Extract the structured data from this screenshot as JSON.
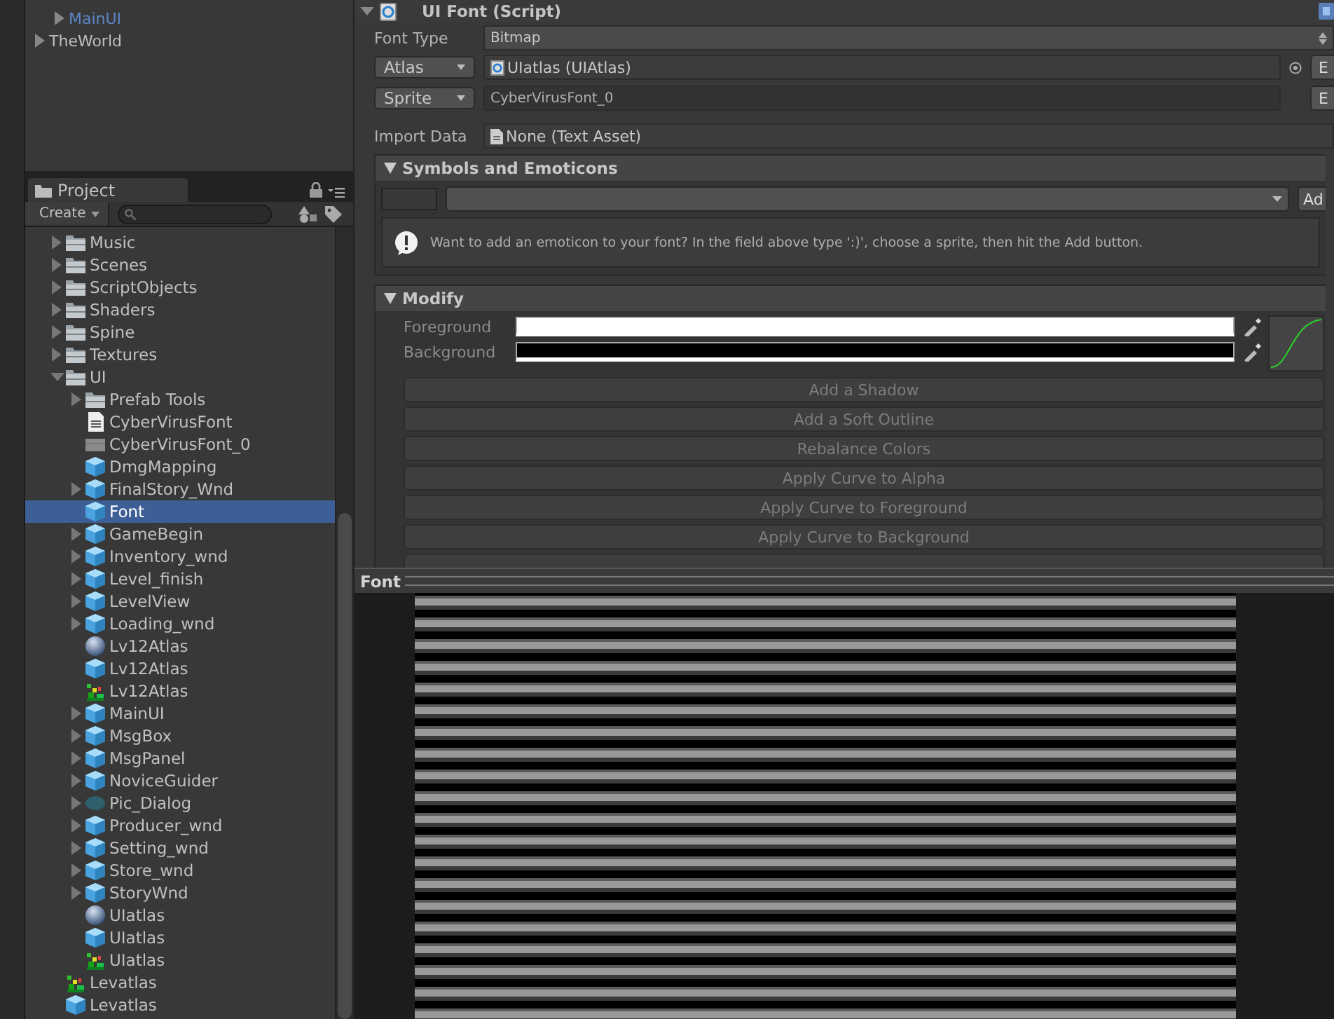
{
  "hierarchy": {
    "items": [
      {
        "children": [
          {
            "label": "MainUI",
            "prefab": true,
            "expanded": false,
            "selected": false
          }
        ]
      },
      {
        "label": "TheWorld",
        "prefab": false,
        "expanded": false,
        "selected": false
      }
    ]
  },
  "project": {
    "tab": "Project",
    "create_button": "Create",
    "tree": [
      {
        "label": "Music",
        "kind": "folder",
        "expanded": false,
        "selected": false
      },
      {
        "label": "Scenes",
        "kind": "folder",
        "expanded": false,
        "selected": false
      },
      {
        "label": "ScriptObjects",
        "kind": "folder",
        "expanded": false,
        "selected": false
      },
      {
        "label": "Shaders",
        "kind": "folder",
        "expanded": false,
        "selected": false
      },
      {
        "label": "Spine",
        "kind": "folder",
        "expanded": false,
        "selected": false
      },
      {
        "label": "Textures",
        "kind": "folder",
        "expanded": false,
        "selected": false
      },
      {
        "label": "UI",
        "kind": "folder",
        "expanded": true,
        "selected": false,
        "children": [
          {
            "label": "Prefab Tools",
            "kind": "folder",
            "expanded": false,
            "selected": false
          },
          {
            "label": "CyberVirusFont",
            "kind": "text",
            "selected": false
          },
          {
            "label": "CyberVirusFont_0",
            "kind": "texture",
            "selected": false
          },
          {
            "label": "DmgMapping",
            "kind": "prefab",
            "selected": false
          },
          {
            "label": "FinalStory_Wnd",
            "kind": "prefab",
            "expanded": false,
            "selected": false
          },
          {
            "label": "Font",
            "kind": "prefab",
            "selected": true
          },
          {
            "label": "GameBegin",
            "kind": "prefab",
            "expanded": false,
            "selected": false
          },
          {
            "label": "Inventory_wnd",
            "kind": "prefab",
            "expanded": false,
            "selected": false
          },
          {
            "label": "Level_finish",
            "kind": "prefab",
            "expanded": false,
            "selected": false
          },
          {
            "label": "LevelView",
            "kind": "prefab",
            "expanded": false,
            "selected": false
          },
          {
            "label": "Loading_wnd",
            "kind": "prefab",
            "expanded": false,
            "selected": false
          },
          {
            "label": "Lv12Atlas",
            "kind": "material",
            "selected": false
          },
          {
            "label": "Lv12Atlas",
            "kind": "prefab",
            "selected": false
          },
          {
            "label": "Lv12Atlas",
            "kind": "atlas",
            "selected": false
          },
          {
            "label": "MainUI",
            "kind": "prefab",
            "expanded": false,
            "selected": false
          },
          {
            "label": "MsgBox",
            "kind": "prefab",
            "expanded": false,
            "selected": false
          },
          {
            "label": "MsgPanel",
            "kind": "prefab",
            "expanded": false,
            "selected": false
          },
          {
            "label": "NoviceGuider",
            "kind": "prefab",
            "expanded": false,
            "selected": false
          },
          {
            "label": "Pic_Dialog",
            "kind": "model",
            "expanded": false,
            "selected": false
          },
          {
            "label": "Producer_wnd",
            "kind": "prefab",
            "expanded": false,
            "selected": false
          },
          {
            "label": "Setting_wnd",
            "kind": "prefab",
            "expanded": false,
            "selected": false
          },
          {
            "label": "Store_wnd",
            "kind": "prefab",
            "expanded": false,
            "selected": false
          },
          {
            "label": "StoryWnd",
            "kind": "prefab",
            "expanded": false,
            "selected": false
          },
          {
            "label": "UIatlas",
            "kind": "material",
            "selected": false
          },
          {
            "label": "UIatlas",
            "kind": "prefab",
            "selected": false
          },
          {
            "label": "UIatlas",
            "kind": "atlas",
            "selected": false
          }
        ]
      },
      {
        "label": "Levatlas",
        "kind": "atlas",
        "selected": false
      },
      {
        "label": "Levatlas",
        "kind": "prefab",
        "selected": false
      }
    ]
  },
  "inspector": {
    "component": {
      "title": "UI Font (Script)",
      "expanded": true
    },
    "font_type": {
      "label": "Font Type",
      "value": "Bitmap"
    },
    "atlas": {
      "mode": "Atlas",
      "value": "UIatlas (UIAtlas)",
      "edit_button": "E"
    },
    "sprite": {
      "mode": "Sprite",
      "value": "CyberVirusFont_0",
      "edit_button": "E"
    },
    "import_data": {
      "label": "Import Data",
      "value": "None (Text Asset)"
    },
    "sections": [
      {
        "kind": "emoticons",
        "title": "Symbols and Emoticons",
        "expanded": true,
        "add_button": "Ad",
        "message": "Want to add an emoticon to your font? In the field above type ':)', choose a sprite, then hit the Add button."
      },
      {
        "kind": "modify",
        "title": "Modify",
        "expanded": true,
        "colors": [
          {
            "label": "Foreground",
            "color": "#ffffff"
          },
          {
            "label": "Background",
            "color": "#000000"
          }
        ],
        "buttons": [
          {
            "label": "Add a Shadow",
            "disabled": true
          },
          {
            "label": "Add a Soft Outline",
            "disabled": true
          },
          {
            "label": "Rebalance Colors",
            "disabled": true
          },
          {
            "label": "Apply Curve to Alpha",
            "disabled": true
          },
          {
            "label": "Apply Curve to Foreground",
            "disabled": true
          },
          {
            "label": "Apply Curve to Background",
            "disabled": true
          }
        ]
      }
    ]
  },
  "preview": {
    "title": "Font"
  }
}
